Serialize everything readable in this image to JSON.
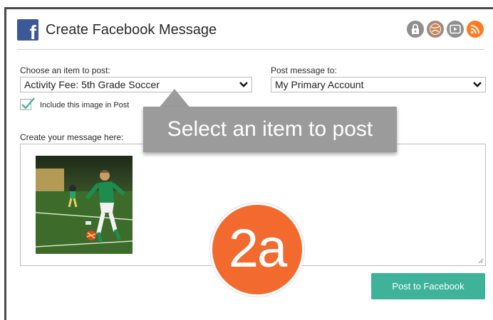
{
  "header": {
    "title": "Create Facebook Message",
    "logo_letter": "f",
    "icons": [
      "lock-icon",
      "globe-icon",
      "video-icon",
      "rss-icon"
    ]
  },
  "form": {
    "item_label": "Choose an item to post:",
    "item_value": "Activity Fee: 5th Grade Soccer",
    "post_to_label": "Post message to:",
    "post_to_value": "My Primary Account",
    "include_image_label": "Include this image in Post",
    "include_image_checked": true,
    "message_label": "Create your message here:",
    "message_value": "",
    "submit_label": "Post to Facebook"
  },
  "annotation": {
    "tooltip_text": "Select an item to post",
    "step_badge": "2a"
  },
  "colors": {
    "facebook_blue": "#3b5998",
    "post_button": "#3fb39a",
    "badge": "#f26a2e",
    "rss": "#ff7a21",
    "tooltip": "#9b9b9b"
  }
}
